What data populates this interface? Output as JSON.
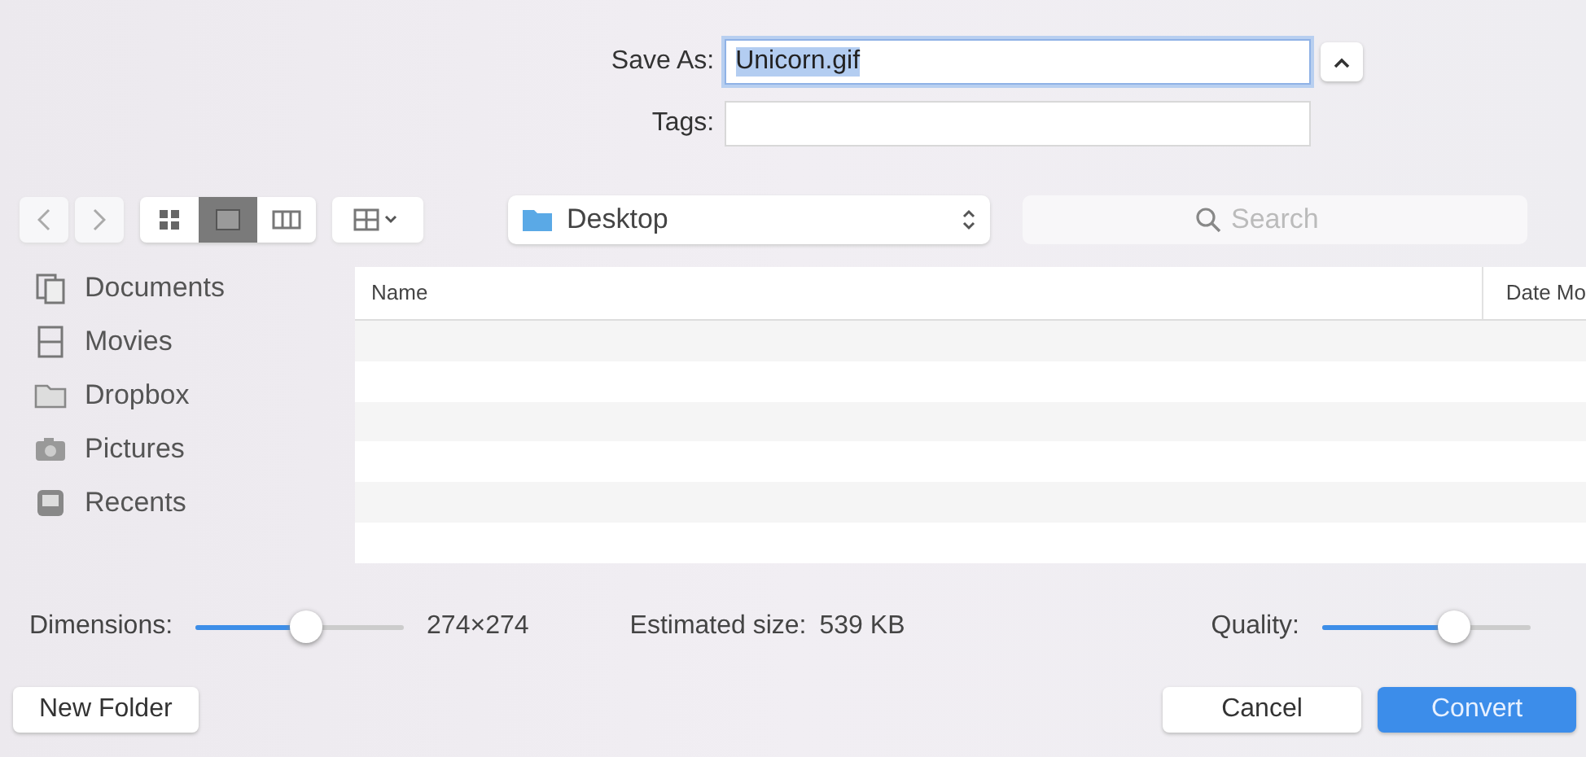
{
  "save_as": {
    "label": "Save As:",
    "value": "Unicorn.gif"
  },
  "tags": {
    "label": "Tags:"
  },
  "view_modes": [
    {
      "kind": "icons",
      "selected": false
    },
    {
      "kind": "list",
      "selected": true
    },
    {
      "kind": "columns",
      "selected": false
    }
  ],
  "location": {
    "label": "Desktop"
  },
  "search": {
    "placeholder": "Search"
  },
  "sidebar": {
    "items": [
      {
        "kind": "documents",
        "label": "Documents"
      },
      {
        "kind": "movies",
        "label": "Movies"
      },
      {
        "kind": "folder",
        "label": "Dropbox"
      },
      {
        "kind": "pictures",
        "label": "Pictures"
      },
      {
        "kind": "recents",
        "label": "Recents"
      }
    ]
  },
  "table": {
    "columns": [
      "Name",
      "Date Mo"
    ]
  },
  "dimensions": {
    "label": "Dimensions:",
    "level": 0.53,
    "reading": "274×274"
  },
  "estimated_size": {
    "label": "Estimated size:",
    "value": "539 KB"
  },
  "quality": {
    "label": "Quality:",
    "level": 0.63
  },
  "buttons": {
    "new_folder": "New Folder",
    "cancel": "Cancel",
    "convert": "Convert"
  }
}
